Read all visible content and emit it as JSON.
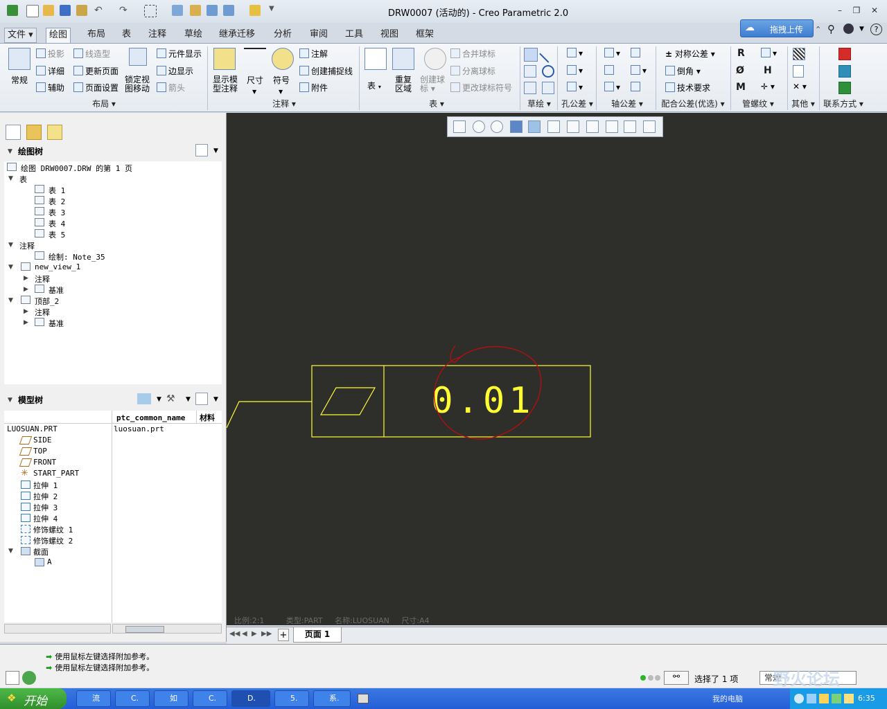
{
  "window": {
    "title": "DRW0007 (活动的) - Creo Parametric 2.0",
    "upload_label": "拖拽上传"
  },
  "tabs": [
    "文件",
    "绘图",
    "布局",
    "表",
    "注释",
    "草绘",
    "继承迁移",
    "分析",
    "审阅",
    "工具",
    "视图",
    "框架"
  ],
  "ribbon": {
    "layout_group": {
      "big": "常规",
      "items": [
        "投影",
        "线造型",
        "详细",
        "更新页面",
        "辅助",
        "页面设置"
      ],
      "lock_view": [
        "锁定视",
        "图移动"
      ],
      "items2": [
        "元件显示",
        "边显示",
        "箭头"
      ],
      "label": "布局"
    },
    "annot_group": {
      "show_model": [
        "显示模",
        "型注释"
      ],
      "dimension": "尺寸",
      "symbol": "符号",
      "items": [
        "注解",
        "创建捕捉线",
        "附件"
      ],
      "label": "注释"
    },
    "table_group": {
      "table": "表",
      "repeat": [
        "重复",
        "区域"
      ],
      "create_balloon": [
        "创建球",
        "标"
      ],
      "items": [
        "合并球标",
        "分离球标",
        "更改球标符号"
      ],
      "label": "表"
    },
    "group_labels": [
      "草绘",
      "孔公差",
      "轴公差",
      "配合公差(优选)",
      "管螺纹",
      "其他",
      "联系方式"
    ],
    "fit_items": [
      "对称公差",
      "倒角",
      "技术要求"
    ],
    "thread_symbols": [
      "R",
      "H",
      "M"
    ]
  },
  "tree": {
    "drawing_header": "绘图树",
    "items": [
      "绘图 DRW0007.DRW 的第 1 页",
      "表",
      "表 1",
      "表 2",
      "表 3",
      "表 4",
      "表 5",
      "注释",
      "绘制: Note_35",
      "new_view_1",
      "注释",
      "基准",
      "顶部_2",
      "注释",
      "基准"
    ],
    "model_header": "模型树",
    "columns": [
      "ptc_common_name",
      "材料"
    ],
    "root": "LUOSUAN.PRT",
    "root_value": "luosuan.prt",
    "model_items": [
      "SIDE",
      "TOP",
      "FRONT",
      "START_PART",
      "拉伸 1",
      "拉伸 2",
      "拉伸 3",
      "拉伸 4",
      "修饰螺纹 1",
      "修饰螺纹 2",
      "截面",
      "A"
    ]
  },
  "canvas": {
    "tolerance_value": "0.01",
    "status": [
      "比例:2:1",
      "类型:PART",
      "名称:LUOSUAN",
      "尺寸:A4"
    ],
    "page_tab": "页面 1"
  },
  "messages": [
    "使用鼠标左键选择附加参考。",
    "使用鼠标左键选择附加参考。"
  ],
  "status_bar": {
    "selected": "选择了 1 项",
    "filter": "常规",
    "watermark": "野火论坛"
  },
  "taskbar": {
    "start": "开始",
    "tasks": [
      "流",
      "C.",
      "如",
      "C.",
      "D.",
      "5.",
      "系."
    ],
    "tray_time": "6:35",
    "tray_text": "我的电脑"
  },
  "colors": {
    "canvas_bg": "#2e2e2a",
    "annotation_yellow": "#ffff33",
    "markup_red": "#b01010"
  }
}
